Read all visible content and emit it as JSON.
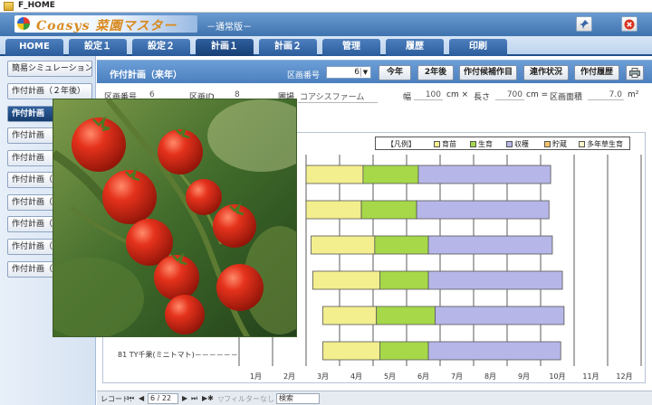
{
  "window": {
    "title": "F_HOME"
  },
  "header": {
    "logo_text": "Coasys 菜園マスター",
    "edition": "－通常版－"
  },
  "tabs": [
    {
      "label": "HOME",
      "active": false
    },
    {
      "label": "設定１",
      "active": false
    },
    {
      "label": "設定２",
      "active": false
    },
    {
      "label": "計画１",
      "active": true
    },
    {
      "label": "計画２",
      "active": false
    },
    {
      "label": "管理",
      "active": false
    },
    {
      "label": "履歴",
      "active": false
    },
    {
      "label": "印刷",
      "active": false
    }
  ],
  "sidebar": {
    "items": [
      {
        "label": "簡易シミュレーション"
      },
      {
        "label": "作付計画（２年後）"
      },
      {
        "label": "作付計画"
      },
      {
        "label": "作付計画"
      },
      {
        "label": "作付計画"
      },
      {
        "label": "作付計画（"
      },
      {
        "label": "作付計画（"
      },
      {
        "label": "作付計画（"
      },
      {
        "label": "作付計画（"
      },
      {
        "label": "作付計画（"
      }
    ]
  },
  "content": {
    "title": "作付計画（来年）",
    "plot_no_label": "区画番号",
    "plot_no_value": "6",
    "buttons": {
      "this_year": "今年",
      "two_years": "2年後",
      "candidates": "作付候補作目",
      "status": "連作状況",
      "history": "作付履歴"
    },
    "info": {
      "plot_no_label": "区画番号",
      "plot_no": "6",
      "plot_id_label": "区画ID",
      "plot_id": "8",
      "farm_label": "圃場",
      "farm": "コアシスファーム",
      "width_label": "幅",
      "width": "100",
      "width_unit": "cm ×",
      "length_label": "長さ",
      "length": "700",
      "length_unit": "cm =",
      "area_label": "区画面積",
      "area": "7.0",
      "area_unit": "m²"
    }
  },
  "chart_data": {
    "type": "gantt",
    "legend": [
      "【凡例】",
      "育苗",
      "生育",
      "収穫",
      "貯蔵",
      "多年草生育"
    ],
    "colors": {
      "育苗": "#f3ee8e",
      "生育": "#a6d84a",
      "収穫": "#b6b6e8",
      "貯蔵": "#f3c36a",
      "多年草生育": "#fbf5c8"
    },
    "months": [
      "1月",
      "2月",
      "3月",
      "4月",
      "5月",
      "6月",
      "7月",
      "8月",
      "9月",
      "10月",
      "11月",
      "12月"
    ],
    "rows": [
      {
        "label": "",
        "segments": [
          {
            "phase": "育苗",
            "start": 3.0,
            "end": 4.7
          },
          {
            "phase": "生育",
            "start": 4.7,
            "end": 6.35
          },
          {
            "phase": "収穫",
            "start": 6.35,
            "end": 10.3
          }
        ]
      },
      {
        "label": "",
        "segments": [
          {
            "phase": "育苗",
            "start": 3.0,
            "end": 4.65
          },
          {
            "phase": "生育",
            "start": 4.65,
            "end": 6.3
          },
          {
            "phase": "収穫",
            "start": 6.3,
            "end": 10.25
          }
        ]
      },
      {
        "label": "",
        "segments": [
          {
            "phase": "育苗",
            "start": 3.15,
            "end": 5.05
          },
          {
            "phase": "生育",
            "start": 5.05,
            "end": 6.65
          },
          {
            "phase": "収穫",
            "start": 6.65,
            "end": 10.35
          }
        ]
      },
      {
        "label": "",
        "segments": [
          {
            "phase": "育苗",
            "start": 3.2,
            "end": 5.2
          },
          {
            "phase": "生育",
            "start": 5.2,
            "end": 6.65
          },
          {
            "phase": "収穫",
            "start": 6.65,
            "end": 10.65
          }
        ]
      },
      {
        "label": "",
        "segments": [
          {
            "phase": "育苗",
            "start": 3.5,
            "end": 5.1
          },
          {
            "phase": "生育",
            "start": 5.1,
            "end": 6.85
          },
          {
            "phase": "収穫",
            "start": 6.85,
            "end": 10.7
          }
        ]
      },
      {
        "label": "81 TY千果(ミニトマト)－－－－－－",
        "segments": [
          {
            "phase": "育苗",
            "start": 3.5,
            "end": 5.2
          },
          {
            "phase": "生育",
            "start": 5.2,
            "end": 6.65
          },
          {
            "phase": "収穫",
            "start": 6.65,
            "end": 10.6
          }
        ]
      }
    ]
  },
  "footer": {
    "record_label": "レコード:",
    "record_nav_first": "⏮",
    "record_nav_prev": "◀",
    "record_position": "6 / 22",
    "record_nav_next": "▶",
    "record_nav_last": "⏭",
    "record_nav_new": "▶✱",
    "filter": "フィルターなし",
    "search": "検索"
  },
  "icons": {
    "settings": "pin-icon",
    "close": "close-icon",
    "print": "print-icon"
  }
}
